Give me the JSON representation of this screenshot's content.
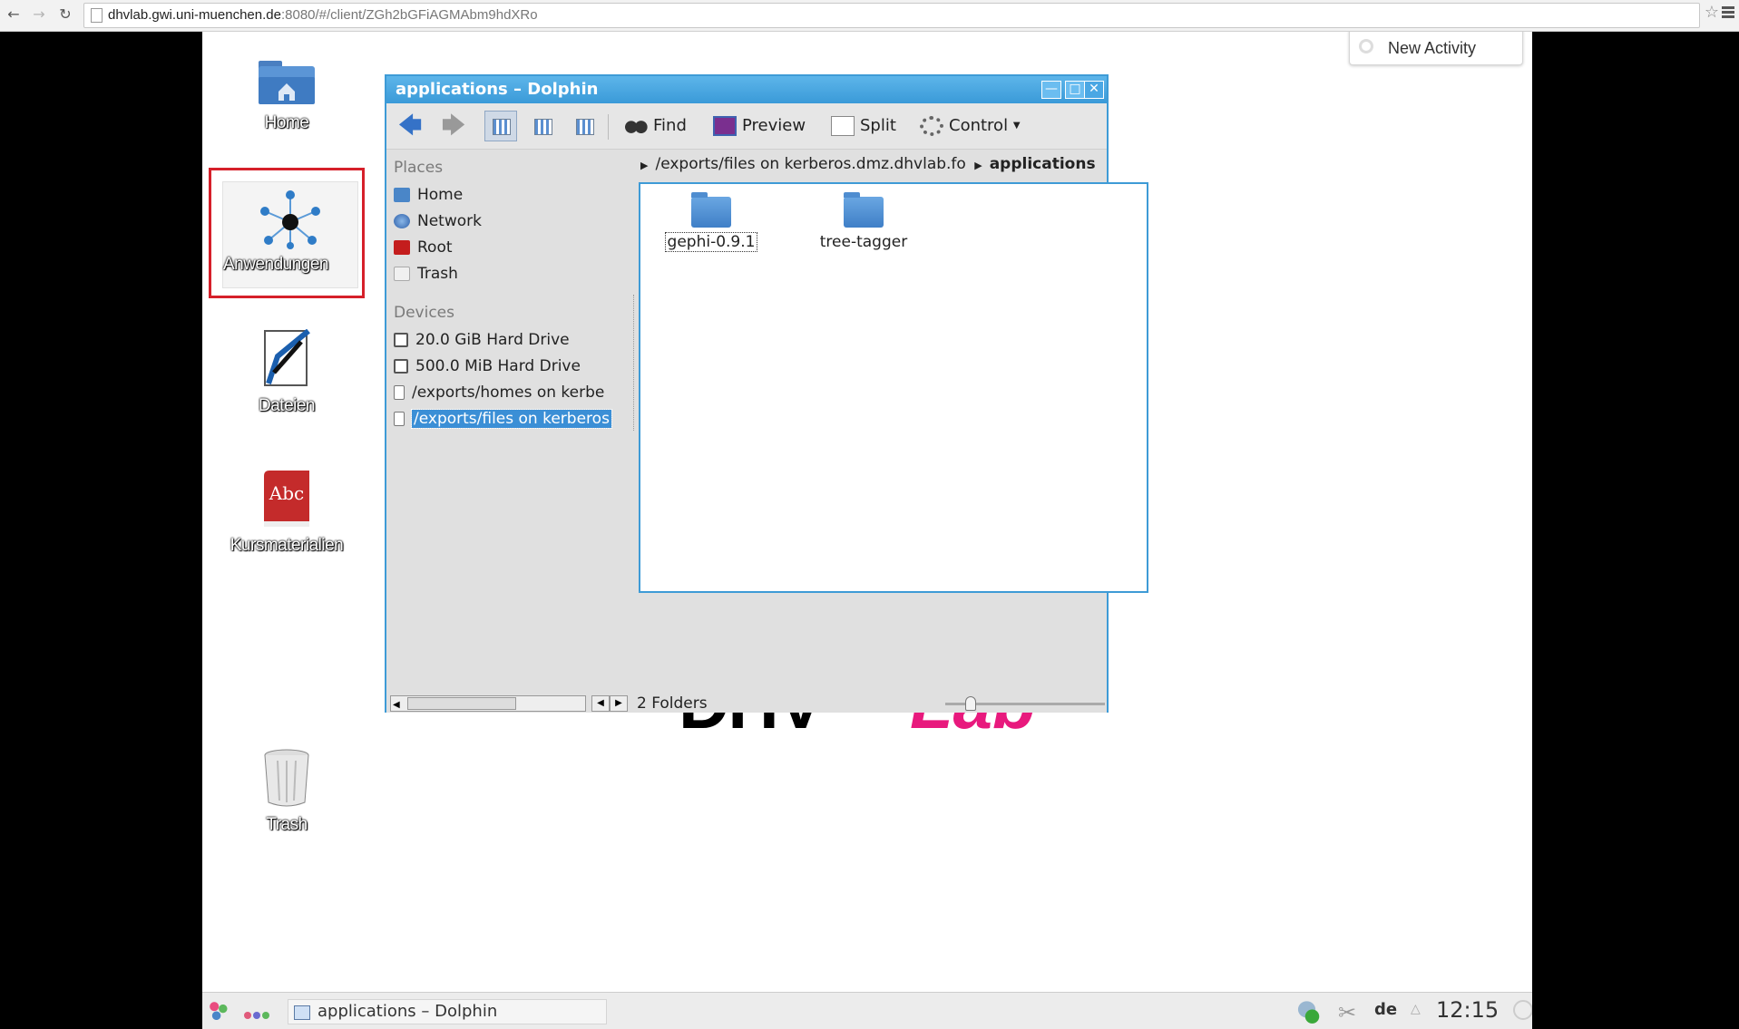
{
  "browser": {
    "url_host": "dhvlab.gwi.uni-muenchen.de",
    "url_rest": ":8080/#/client/ZGh2bGFiAGMAbm9hdXRo",
    "icons": [
      "back-arrow-icon",
      "forward-arrow-icon",
      "reload-icon",
      "page-icon",
      "star-icon",
      "menu-icon"
    ]
  },
  "desktop": {
    "icons": [
      {
        "label": "Home"
      },
      {
        "label": "Anwendungen"
      },
      {
        "label": "Dateien"
      },
      {
        "label": "Kursmaterialien"
      },
      {
        "label": "Trash"
      }
    ],
    "new_activity": "New Activity",
    "logo": {
      "part1": "DHV",
      "part2": "Lab",
      "accent_color": "#e8197d"
    }
  },
  "window": {
    "title": "applications – Dolphin",
    "toolbar": {
      "find": "Find",
      "preview": "Preview",
      "split": "Split",
      "control": "Control"
    },
    "places": {
      "title": "Places",
      "items": [
        "Home",
        "Network",
        "Root",
        "Trash"
      ]
    },
    "devices": {
      "title": "Devices",
      "items": [
        "20.0 GiB Hard Drive",
        "500.0 MiB Hard Drive",
        "/exports/homes on kerbe",
        "/exports/files on kerberos"
      ],
      "selected_index": 3
    },
    "breadcrumb": {
      "parent": "/exports/files on kerberos.dmz.dhvlab.fo",
      "current": "applications"
    },
    "folders": [
      "gephi-0.9.1",
      "tree-tagger"
    ],
    "status": "2 Folders",
    "accent_color": "#3e9bd6"
  },
  "taskbar": {
    "task": "applications – Dolphin",
    "lang": "de",
    "clock": "12:15"
  }
}
